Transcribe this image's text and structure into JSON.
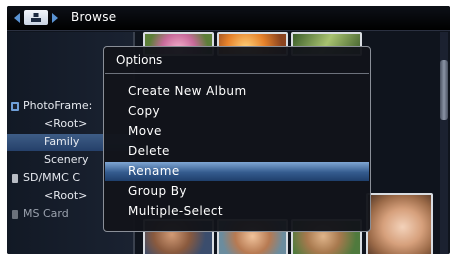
{
  "header": {
    "title": "Browse",
    "nav_left_icon": "arrow-left-icon",
    "nav_home_icon": "photo-frame-home-icon",
    "nav_right_icon": "arrow-right-icon",
    "accent_color": "#5a93d4"
  },
  "sidebar": {
    "items": [
      {
        "label": "PhotoFrame:",
        "icon": "photo-frame-device-icon"
      },
      {
        "label": "<Root>"
      },
      {
        "label": "Family",
        "selected": true
      },
      {
        "label": "Scenery"
      },
      {
        "label": "SD/MMC C",
        "icon": "memory-card-icon"
      },
      {
        "label": "<Root>"
      },
      {
        "label": "MS Card",
        "icon": "memory-card-icon"
      }
    ]
  },
  "thumbnails": [
    {
      "subject": "pink-flower"
    },
    {
      "subject": "orange-flower"
    },
    {
      "subject": "green-leaves"
    },
    {
      "subject": "baby-blanket"
    },
    {
      "subject": "baby-smile"
    },
    {
      "subject": "baby-green"
    },
    {
      "subject": "woman-portrait"
    }
  ],
  "options_dialog": {
    "title": "Options",
    "items": [
      {
        "label": "Create New Album"
      },
      {
        "label": "Copy"
      },
      {
        "label": "Move"
      },
      {
        "label": "Delete"
      },
      {
        "label": "Rename",
        "selected": true
      },
      {
        "label": "Group By"
      },
      {
        "label": "Multiple-Select"
      }
    ],
    "highlight_color": "#345b8e"
  }
}
